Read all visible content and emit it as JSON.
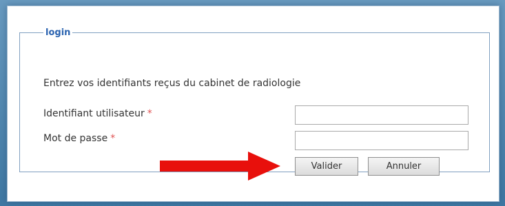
{
  "fieldset": {
    "legend": "login"
  },
  "intro_text": "Entrez vos identifiants reçus du cabinet de radiologie",
  "fields": {
    "user": {
      "label": "Identifiant utilisateur",
      "required_mark": "*",
      "value": ""
    },
    "password": {
      "label": "Mot de passe",
      "required_mark": "*",
      "value": ""
    }
  },
  "buttons": {
    "submit": "Valider",
    "cancel": "Annuler"
  },
  "annotation": {
    "arrow_color": "#e8100c",
    "arrow_icon": "right-arrow-icon"
  },
  "colors": {
    "legend": "#2a63b0",
    "required": "#e05252",
    "border": "#7f9fbf"
  }
}
